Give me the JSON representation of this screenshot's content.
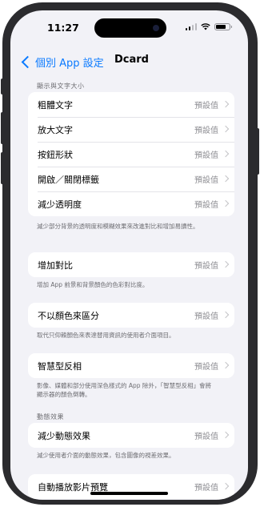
{
  "status": {
    "time": "11:27"
  },
  "nav": {
    "back_label": "個別 App 設定",
    "title": "Dcard"
  },
  "sections": {
    "display_text": {
      "header": "顯示與文字大小",
      "rows": [
        {
          "label": "粗體文字",
          "value": "預設值"
        },
        {
          "label": "放大文字",
          "value": "預設值"
        },
        {
          "label": "按鈕形狀",
          "value": "預設值"
        },
        {
          "label": "開啟／關閉標籤",
          "value": "預設值"
        },
        {
          "label": "減少透明度",
          "value": "預設值"
        }
      ],
      "footer": "減少部分背景的透明度和模糊效果來改進對比和增加易讀性。"
    },
    "contrast": {
      "label": "增加對比",
      "value": "預設值",
      "footer": "增加 App 前景和背景顏色的色彩對比度。"
    },
    "differentiate": {
      "label": "不以顏色來區分",
      "value": "預設值",
      "footer": "取代只仰賴顏色來表達替用資訊的使用者介面項目。"
    },
    "invert": {
      "label": "智慧型反相",
      "value": "預設值",
      "footer": "影像、媒體和部分使用深色樣式的 App 除外，「智慧型反相」會將顯示器的顏色倒轉。"
    },
    "motion": {
      "header": "動態效果",
      "rows": [
        {
          "label": "減少動態效果",
          "value": "預設值"
        }
      ],
      "footer": "減少使用者介面的動態效果，包含圖像的視差效果。"
    },
    "autoplay": {
      "label": "自動播放影片預覽",
      "value": "預設值"
    }
  },
  "colors": {
    "accent": "#0a7aff",
    "background": "#f2f2f7"
  },
  "icons": {
    "back": "chevron-left-icon",
    "row": "chevron-right-icon",
    "wifi": "wifi-icon",
    "battery": "battery-icon",
    "signal": "cellular-signal-icon"
  }
}
